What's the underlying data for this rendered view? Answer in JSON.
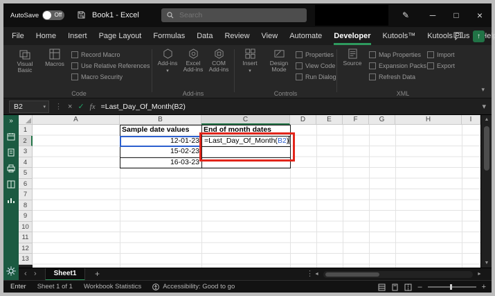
{
  "colors": {
    "accent_green": "#217346",
    "tab_underline_green": "#2e9b5e",
    "annotation_red": "#e2251a",
    "reference_blue": "#2b5fce",
    "sidebar_green": "#1b5a41"
  },
  "titlebar": {
    "autosave_label": "AutoSave",
    "autosave_state": "Off",
    "workbook_title": "Book1 - Excel",
    "search_placeholder": "Search"
  },
  "menu": {
    "tabs": [
      "File",
      "Home",
      "Insert",
      "Page Layout",
      "Formulas",
      "Data",
      "Review",
      "View",
      "Automate",
      "Developer",
      "Kutools™",
      "Kutools Plus",
      "Help"
    ],
    "active_tab": "Developer"
  },
  "ribbon": {
    "code": {
      "group_label": "Code",
      "visual_basic": "Visual Basic",
      "macros": "Macros",
      "record_macro": "Record Macro",
      "use_relative_references": "Use Relative References",
      "macro_security": "Macro Security"
    },
    "addins": {
      "group_label": "Add-ins",
      "addins": "Add-ins",
      "excel_addins": "Excel Add-ins",
      "com_addins": "COM Add-ins"
    },
    "controls": {
      "group_label": "Controls",
      "insert": "Insert",
      "design_mode": "Design Mode",
      "properties": "Properties",
      "view_code": "View Code",
      "run_dialog": "Run Dialog"
    },
    "xml": {
      "group_label": "XML",
      "source": "Source",
      "map_properties": "Map Properties",
      "expansion_packs": "Expansion Packs",
      "refresh_data": "Refresh Data",
      "import": "Import",
      "export": "Export"
    }
  },
  "formula_bar": {
    "name_box": "B2",
    "fx_label": "fx",
    "formula": "=Last_Day_Of_Month(B2)"
  },
  "grid": {
    "columns": [
      "A",
      "B",
      "C",
      "D",
      "E",
      "F",
      "G",
      "H",
      "I"
    ],
    "rows": [
      "1",
      "2",
      "3",
      "4",
      "5",
      "6",
      "7",
      "8",
      "9",
      "10",
      "11",
      "12",
      "13"
    ],
    "cells": {
      "b1": "Sample date values",
      "c1": "End of month dates",
      "b2": "12-01-23",
      "b3": "15-02-23",
      "b4": "16-03-23",
      "c2_prefix": "=Last_Day_Of_Month(",
      "c2_ref": "B2",
      "c2_suffix": ")"
    }
  },
  "sheet_bar": {
    "tabs": [
      "Sheet1"
    ],
    "active_tab": "Sheet1"
  },
  "status_bar": {
    "mode": "Enter",
    "sheet_info": "Sheet 1 of 1",
    "workbook_statistics": "Workbook Statistics",
    "accessibility": "Accessibility: Good to go"
  }
}
